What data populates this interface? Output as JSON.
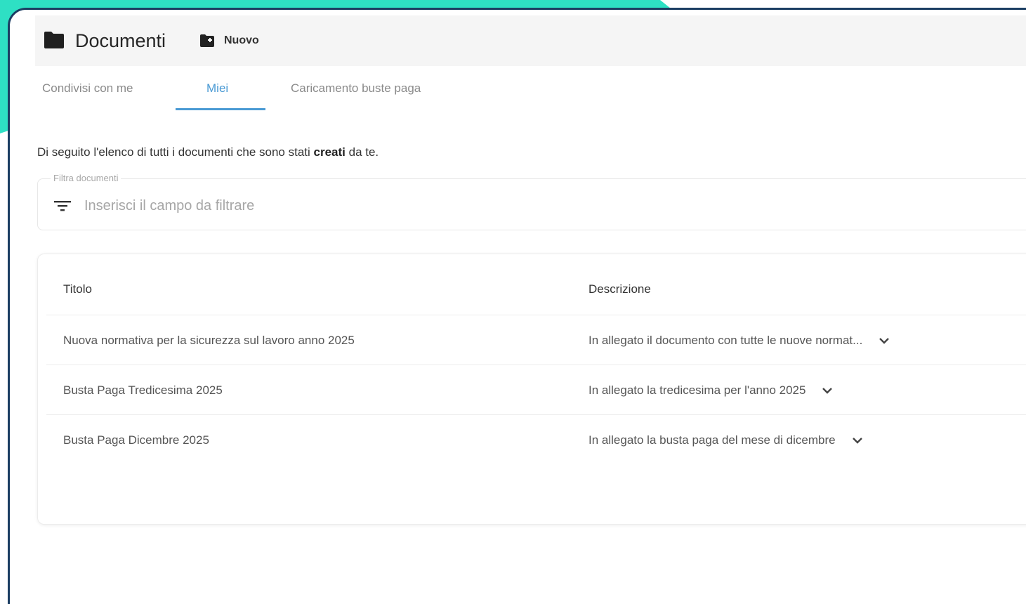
{
  "colors": {
    "teal": "#2ee0c4",
    "frame": "#1c3e63",
    "accent": "#4a9ad4"
  },
  "header": {
    "title": "Documenti",
    "title_icon": "folder-icon",
    "new_button_label": "Nuovo",
    "new_button_icon": "new-folder-icon"
  },
  "tabs": [
    {
      "label": "Condivisi con me",
      "active": false
    },
    {
      "label": "Miei",
      "active": true
    },
    {
      "label": "Caricamento buste paga",
      "active": false
    }
  ],
  "intro": {
    "text_before": "Di seguito l'elenco di tutti i documenti che sono stati ",
    "text_bold": "creati",
    "text_after": " da te."
  },
  "filter": {
    "legend": "Filtra documenti",
    "placeholder": "Inserisci il campo da filtrare",
    "value": "",
    "icon": "filter-icon"
  },
  "table": {
    "columns": [
      "Titolo",
      "Descrizione"
    ],
    "rows": [
      {
        "title": "Nuova normativa per la sicurezza sul lavoro anno 2025",
        "description": "In allegato il documento con tutte le nuove normat..."
      },
      {
        "title": "Busta Paga Tredicesima 2025",
        "description": "In allegato la tredicesima per l'anno 2025"
      },
      {
        "title": "Busta Paga Dicembre 2025",
        "description": "In allegato la busta paga del mese di dicembre"
      }
    ]
  }
}
